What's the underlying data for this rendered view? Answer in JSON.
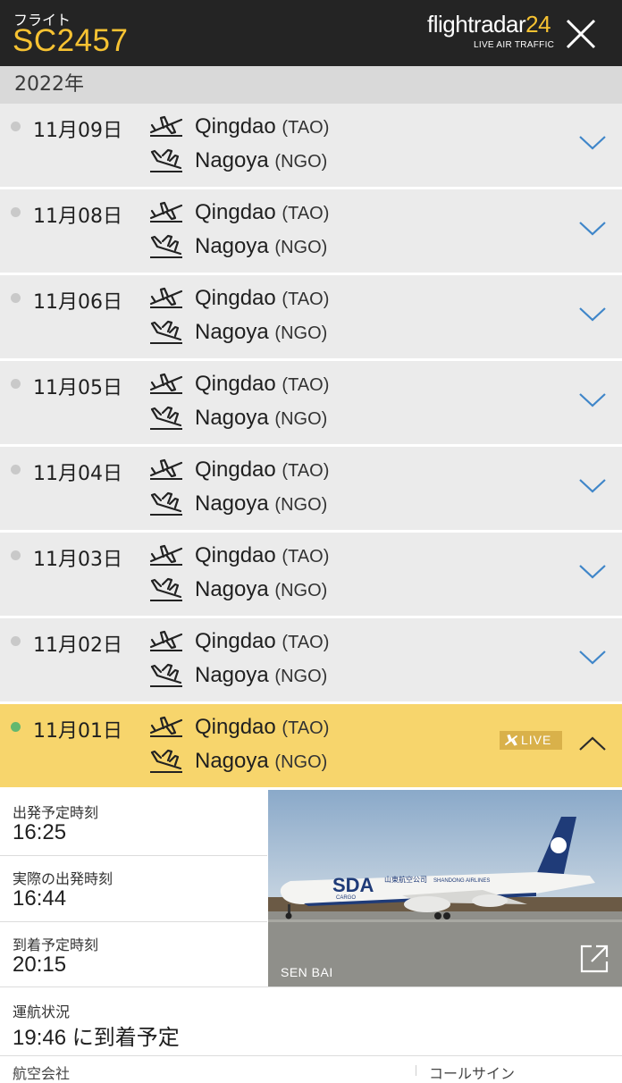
{
  "header": {
    "label": "フライト",
    "flight_number": "SC2457",
    "logo_text": "flightradar",
    "logo_number": "24",
    "logo_tagline": "LIVE AIR TRAFFIC",
    "close_icon": "close-icon"
  },
  "year": "2022年",
  "flights": [
    {
      "date": "11月09日",
      "origin_city": "Qingdao",
      "origin_code": "(TAO)",
      "dest_city": "Nagoya",
      "dest_code": "(NGO)"
    },
    {
      "date": "11月08日",
      "origin_city": "Qingdao",
      "origin_code": "(TAO)",
      "dest_city": "Nagoya",
      "dest_code": "(NGO)"
    },
    {
      "date": "11月06日",
      "origin_city": "Qingdao",
      "origin_code": "(TAO)",
      "dest_city": "Nagoya",
      "dest_code": "(NGO)"
    },
    {
      "date": "11月05日",
      "origin_city": "Qingdao",
      "origin_code": "(TAO)",
      "dest_city": "Nagoya",
      "dest_code": "(NGO)"
    },
    {
      "date": "11月04日",
      "origin_city": "Qingdao",
      "origin_code": "(TAO)",
      "dest_city": "Nagoya",
      "dest_code": "(NGO)"
    },
    {
      "date": "11月03日",
      "origin_city": "Qingdao",
      "origin_code": "(TAO)",
      "dest_city": "Nagoya",
      "dest_code": "(NGO)"
    },
    {
      "date": "11月02日",
      "origin_city": "Qingdao",
      "origin_code": "(TAO)",
      "dest_city": "Nagoya",
      "dest_code": "(NGO)"
    },
    {
      "date": "11月01日",
      "origin_city": "Qingdao",
      "origin_code": "(TAO)",
      "dest_city": "Nagoya",
      "dest_code": "(NGO)",
      "live": true
    }
  ],
  "live_badge": "LIVE",
  "details": {
    "scheduled_departure_label": "出発予定時刻",
    "scheduled_departure": "16:25",
    "actual_departure_label": "実際の出発時刻",
    "actual_departure": "16:44",
    "scheduled_arrival_label": "到着予定時刻",
    "scheduled_arrival": "20:15",
    "status_label": "運航状況",
    "status_value": "19:46 に到着予定",
    "photo_credit": "SEN BAI",
    "airline_livery_text": "SDA",
    "airline_livery_cargo": "CARGO",
    "airline_livery_cn": "山東航空公司",
    "airline_livery_name": "SHANDONG AIRLINES"
  },
  "bottom": {
    "left_label": "航空会社",
    "right_label": "コールサイン"
  },
  "colors": {
    "header_bg": "#242424",
    "accent_yellow": "#f6c232",
    "live_row": "#f7d56c",
    "row_bg": "#ebebeb",
    "chevron_blue": "#3f86c9",
    "live_dot": "#63b86f"
  }
}
